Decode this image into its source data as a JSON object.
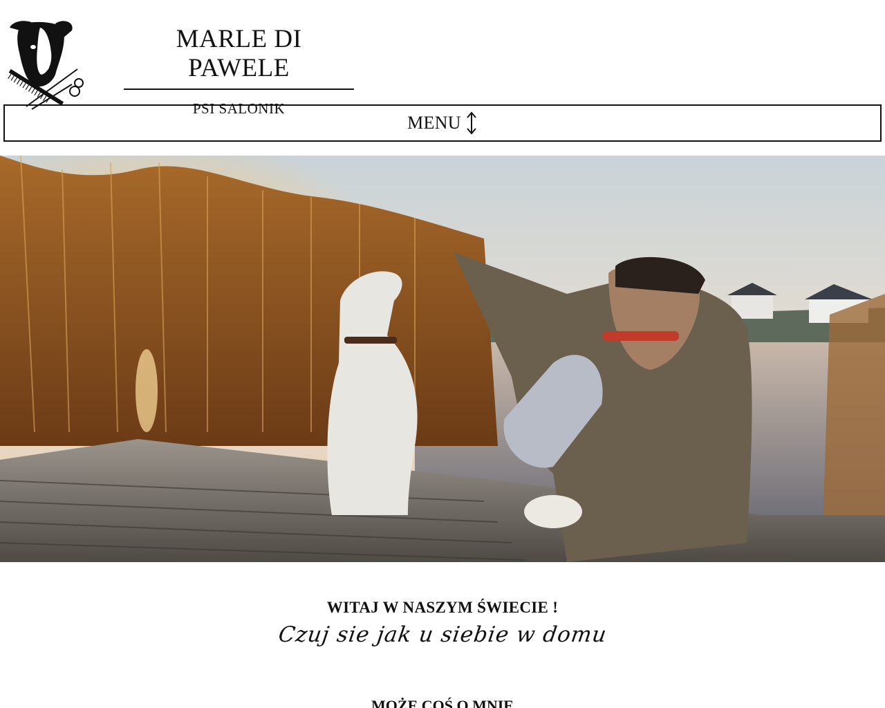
{
  "header": {
    "logo_icon": "dog-grooming-logo",
    "title": "MARLE DI PAWELE",
    "subtitle": "PSI SALONIK"
  },
  "nav": {
    "menu_label": "MENU",
    "menu_icon": "up-down-arrow-icon"
  },
  "hero": {
    "image": "dog-and-man-on-pier-at-sunset"
  },
  "welcome": {
    "title": "WITAJ W NASZYM ŚWIECIE !",
    "subtitle": "Czuj sie jak u siebie w domu"
  },
  "about": {
    "title": "MOŻE COŚ O MNIE"
  }
}
